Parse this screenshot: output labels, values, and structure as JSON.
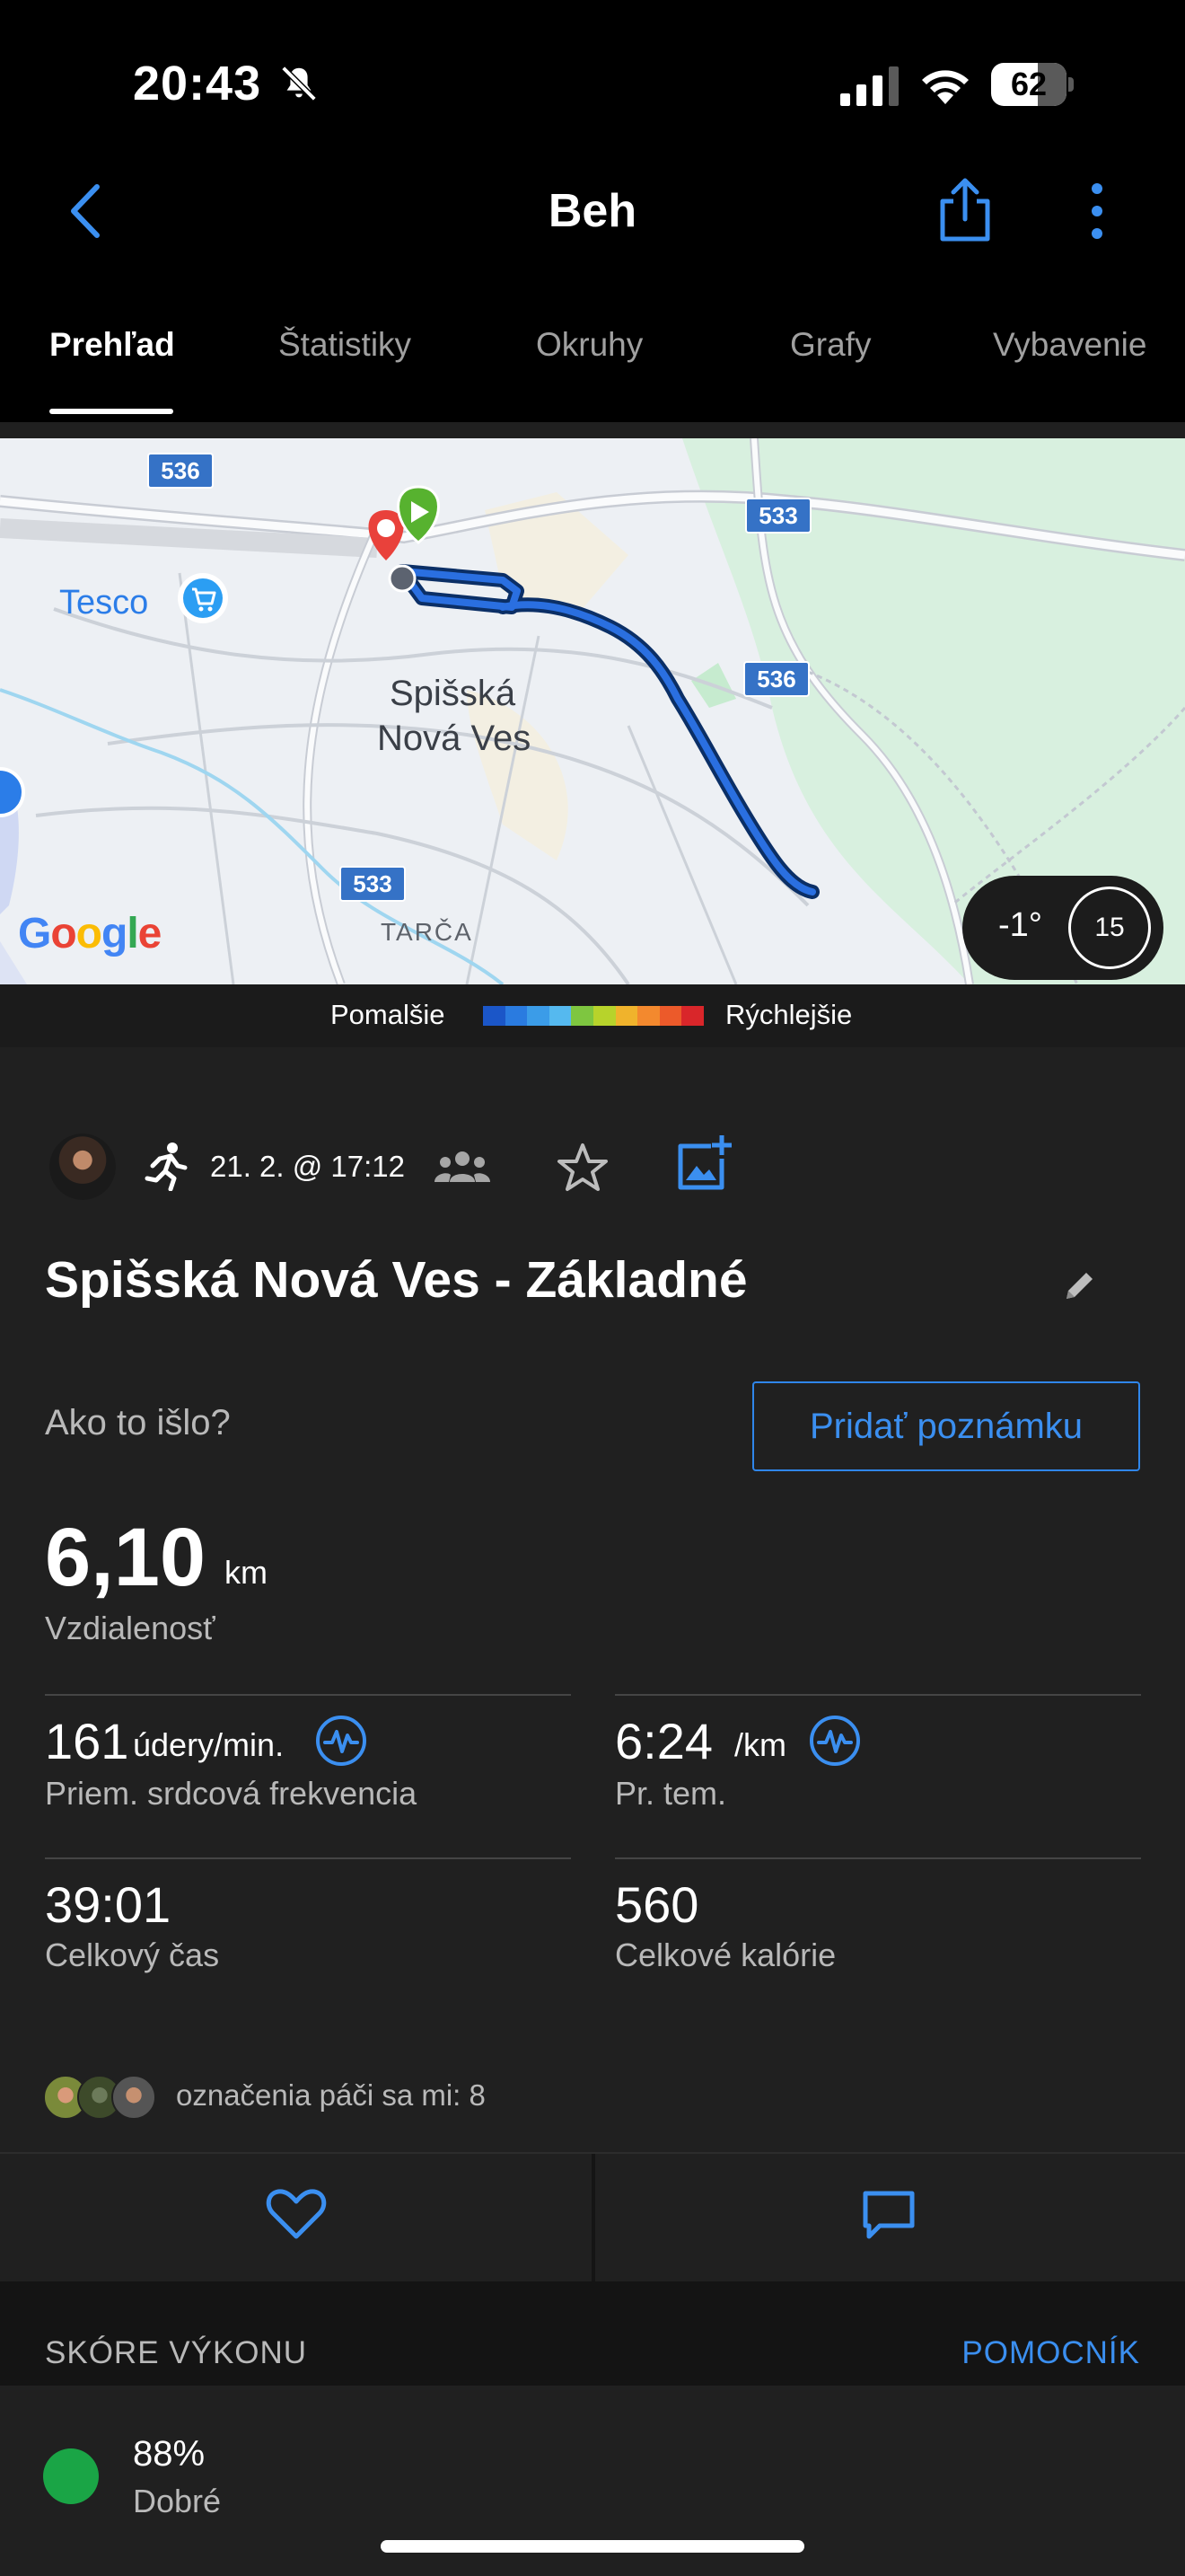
{
  "status": {
    "time": "20:43",
    "battery": "62"
  },
  "header": {
    "title": "Beh"
  },
  "tabs": [
    "Prehľad",
    "Štatistiky",
    "Okruhy",
    "Grafy",
    "Vybavenie"
  ],
  "map": {
    "road_labels": [
      "536",
      "533",
      "536",
      "533"
    ],
    "place_labels": [
      "Tesco",
      "Spišská",
      "Nová Ves",
      "TARČA"
    ],
    "google_logo": "Google",
    "weather": {
      "temperature": "-1°",
      "wind": "15"
    }
  },
  "legend": {
    "slow": "Pomalšie",
    "fast": "Rýchlejšie",
    "colors": [
      "#1b56c8",
      "#2a7be0",
      "#3b9ce8",
      "#55b9ef",
      "#7ec640",
      "#b7d32b",
      "#f0b32c",
      "#f3892e",
      "#ec5a2a",
      "#d9262a"
    ]
  },
  "activity": {
    "date": "21. 2. @ 17:12",
    "name": "Spišská Nová Ves - Základné",
    "how_prompt": "Ako to išlo?",
    "note_button": "Pridať poznámku",
    "distance": {
      "value": "6,10",
      "unit": "km",
      "label": "Vzdialenosť"
    },
    "stats": [
      {
        "value": "161",
        "unit": "údery/min.",
        "label": "Priem. srdcová frekvencia"
      },
      {
        "value": "6:24",
        "unit": "/km",
        "label": "Pr. tem."
      },
      {
        "value": "39:01",
        "unit": "",
        "label": "Celkový čas"
      },
      {
        "value": "560",
        "unit": "",
        "label": "Celkové kalórie"
      }
    ],
    "likes": "označenia páči sa mi: 8"
  },
  "score": {
    "title": "SKÓRE VÝKONU",
    "help": "POMOCNÍK",
    "value": "88%",
    "label": "Dobré",
    "dot_color": "#1aa546"
  },
  "accent_color": "#3b8ff0"
}
